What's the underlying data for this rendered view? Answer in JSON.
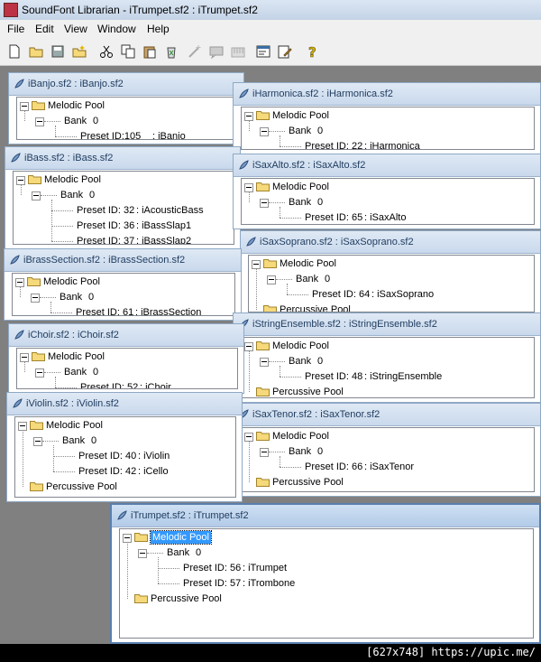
{
  "app": {
    "title": "SoundFont Librarian - iTrumpet.sf2 : iTrumpet.sf2"
  },
  "menu": [
    "File",
    "Edit",
    "View",
    "Window",
    "Help"
  ],
  "toolbar": {
    "icons": [
      "new-file-icon",
      "open-folder-icon",
      "save-icon",
      "new-folder-icon",
      "cut-icon",
      "copy-icon",
      "paste-icon",
      "recycle-icon",
      "wand-icon",
      "comment-icon",
      "piano-icon",
      "properties-icon",
      "edit-icon",
      "help-icon"
    ]
  },
  "windows": [
    {
      "title": "iBanjo.sf2 : iBanjo.sf2",
      "melodic": "Melodic Pool",
      "bank": "Bank",
      "bank_num": "0",
      "presets": [
        {
          "id": "Preset ID:105",
          "name": ": iBanjo"
        }
      ]
    },
    {
      "title": "iHarmonica.sf2 : iHarmonica.sf2",
      "melodic": "Melodic Pool",
      "bank": "Bank",
      "bank_num": "0",
      "presets": [
        {
          "id": "Preset ID: 22",
          "name": ": iHarmonica"
        }
      ]
    },
    {
      "title": "iBass.sf2 : iBass.sf2",
      "melodic": "Melodic Pool",
      "bank": "Bank",
      "bank_num": "0",
      "presets": [
        {
          "id": "Preset ID: 32",
          "name": ": iAcousticBass"
        },
        {
          "id": "Preset ID: 36",
          "name": ": iBassSlap1"
        },
        {
          "id": "Preset ID: 37",
          "name": ": iBassSlap2"
        }
      ]
    },
    {
      "title": "iSaxAlto.sf2 : iSaxAlto.sf2",
      "melodic": "Melodic Pool",
      "bank": "Bank",
      "bank_num": "0",
      "presets": [
        {
          "id": "Preset ID: 65",
          "name": ": iSaxAlto"
        }
      ]
    },
    {
      "title": "iSaxSoprano.sf2 : iSaxSoprano.sf2",
      "melodic": "Melodic Pool",
      "bank": "Bank",
      "bank_num": "0",
      "presets": [
        {
          "id": "Preset ID: 64",
          "name": ": iSaxSoprano"
        }
      ],
      "percussive": "Percussive Pool"
    },
    {
      "title": "iBrassSection.sf2 : iBrassSection.sf2",
      "melodic": "Melodic Pool",
      "bank": "Bank",
      "bank_num": "0",
      "presets": [
        {
          "id": "Preset ID: 61",
          "name": ": iBrassSection"
        }
      ]
    },
    {
      "title": "iStringEnsemble.sf2 : iStringEnsemble.sf2",
      "melodic": "Melodic Pool",
      "bank": "Bank",
      "bank_num": "0",
      "presets": [
        {
          "id": "Preset ID: 48",
          "name": ": iStringEnsemble"
        }
      ],
      "percussive": "Percussive Pool"
    },
    {
      "title": "iChoir.sf2 : iChoir.sf2",
      "melodic": "Melodic Pool",
      "bank": "Bank",
      "bank_num": "0",
      "presets": [
        {
          "id": "Preset ID: 52",
          "name": ": iChoir"
        }
      ]
    },
    {
      "title": "iSaxTenor.sf2 : iSaxTenor.sf2",
      "melodic": "Melodic Pool",
      "bank": "Bank",
      "bank_num": "0",
      "presets": [
        {
          "id": "Preset ID: 66",
          "name": ": iSaxTenor"
        }
      ],
      "percussive": "Percussive Pool"
    },
    {
      "title": "iViolin.sf2 : iViolin.sf2",
      "melodic": "Melodic Pool",
      "bank": "Bank",
      "bank_num": "0",
      "presets": [
        {
          "id": "Preset ID: 40",
          "name": ": iViolin"
        },
        {
          "id": "Preset ID: 42",
          "name": ": iCello"
        }
      ],
      "percussive": "Percussive Pool"
    },
    {
      "title": "iTrumpet.sf2 : iTrumpet.sf2",
      "melodic": "Melodic Pool",
      "bank": "Bank",
      "bank_num": "0",
      "presets": [
        {
          "id": "Preset ID: 56",
          "name": ": iTrumpet"
        },
        {
          "id": "Preset ID: 57",
          "name": ": iTrombone"
        }
      ],
      "percussive": "Percussive Pool",
      "active": true
    }
  ],
  "footer": {
    "text": "[627x748] https://upic.me/"
  },
  "colors": {
    "mdi_background": "#808080",
    "selection": "#3399ff",
    "caption": "#c9d9ec",
    "folder": "#f5d97a"
  }
}
